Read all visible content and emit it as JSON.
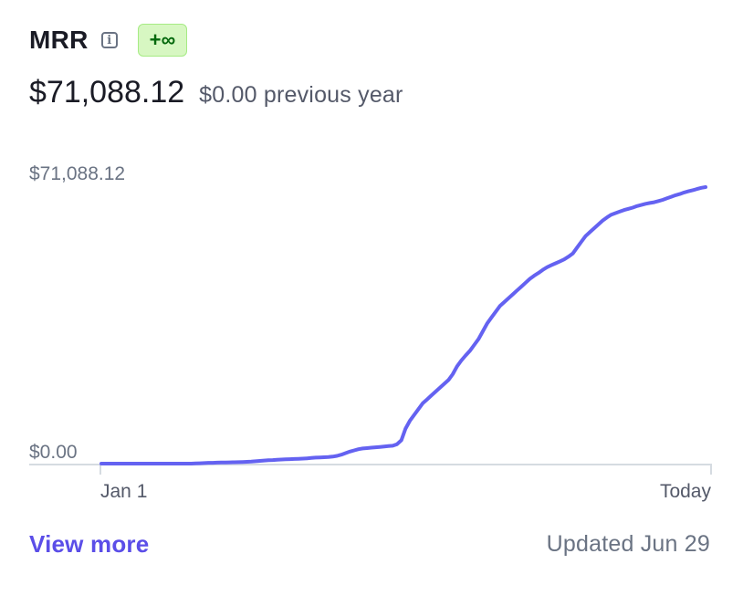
{
  "header": {
    "title": "MRR",
    "info_icon": "info-icon",
    "badge": "+∞"
  },
  "summary": {
    "value": "$71,088.12",
    "previous": "$0.00 previous year"
  },
  "chart_data": {
    "type": "line",
    "ymax_label": "$71,088.12",
    "ymin_label": "$0.00",
    "ylim": [
      0,
      71088.12
    ],
    "x_labels": [
      "Jan 1",
      "Today"
    ],
    "color": "#6462f1",
    "series": [
      {
        "values": [
          0,
          0,
          0,
          0,
          0,
          0,
          0,
          0,
          0,
          0,
          0,
          0,
          0,
          0,
          0,
          0,
          0,
          0,
          0,
          0,
          0,
          0,
          50,
          100,
          150,
          200,
          220,
          250,
          280,
          300,
          320,
          350,
          380,
          420,
          460,
          520,
          600,
          700,
          800,
          860,
          920,
          1000,
          1050,
          1100,
          1150,
          1200,
          1250,
          1300,
          1350,
          1450,
          1550,
          1600,
          1650,
          1700,
          1800,
          2000,
          2300,
          2700,
          3100,
          3400,
          3700,
          3900,
          4000,
          4100,
          4200,
          4300,
          4400,
          4500,
          4600,
          5000,
          6000,
          9000,
          11000,
          12500,
          14000,
          15500,
          16500,
          17500,
          18500,
          19500,
          20500,
          21500,
          23000,
          25000,
          26500,
          27800,
          29000,
          30500,
          32000,
          34000,
          36000,
          37500,
          39000,
          40500,
          41500,
          42500,
          43500,
          44500,
          45500,
          46500,
          47500,
          48300,
          49000,
          49800,
          50500,
          51000,
          51500,
          52000,
          52500,
          53200,
          54000,
          55500,
          57000,
          58500,
          59500,
          60500,
          61500,
          62500,
          63300,
          64000,
          64400,
          64800,
          65200,
          65500,
          65800,
          66200,
          66500,
          66800,
          67000,
          67200,
          67500,
          67800,
          68200,
          68600,
          69000,
          69300,
          69700,
          70000,
          70300,
          70600,
          70900,
          71088.12
        ]
      }
    ],
    "grid": false
  },
  "footer": {
    "link": "View more",
    "updated": "Updated Jun 29"
  }
}
